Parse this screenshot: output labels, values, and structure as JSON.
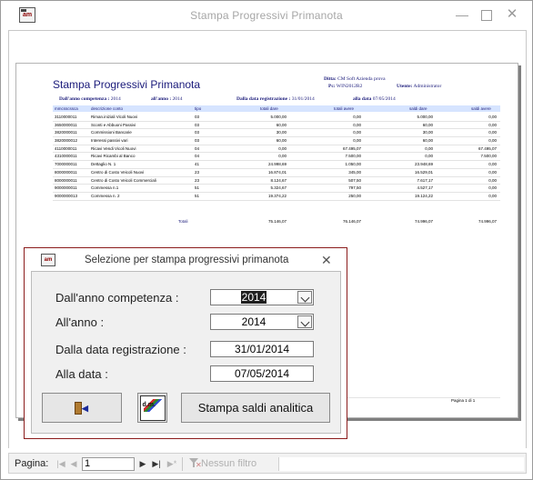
{
  "window": {
    "title": "Stampa Progressivi Primanota",
    "app_icon": "access-app-icon",
    "app_icon_text": "am",
    "controls": {
      "minimize": "—",
      "maximize": "",
      "close": "✕"
    }
  },
  "report": {
    "title": "Stampa Progressivi Primanota",
    "meta": {
      "ditta_label": "Ditta:",
      "ditta_value": "CM Soft Azienda prova",
      "pc_label": "Pc:",
      "pc_value": "WIN2012R2",
      "utente_label": "Utente:",
      "utente_value": "Administrator"
    },
    "params": {
      "anno_comp_label": "Dall'anno competenza :",
      "anno_comp_value": "2014",
      "anno_label": "all'anno :",
      "anno_value": "2014",
      "data_reg_label": "Dalla data registrazione :",
      "data_reg_value": "31/01/2014",
      "alla_data_label": "alla data",
      "alla_data_value": "07/05/2014"
    },
    "columns": [
      "mmcsscssca",
      "descrizione conto",
      "tipo",
      "totali dare",
      "totali avere",
      "saldi dare",
      "saldi avere"
    ],
    "rows": [
      [
        "3110000011",
        "Riman.iniziali Vicoli Nuovi",
        "03",
        "5.000,00",
        "0,00",
        "5.000,00",
        "0,00"
      ],
      [
        "3650000011",
        "Sconti e Abbuoni Passivi",
        "03",
        "60,00",
        "0,00",
        "60,00",
        "0,00"
      ],
      [
        "3820000011",
        "Commissioni Bancarie",
        "03",
        "30,00",
        "0,00",
        "30,00",
        "0,00"
      ],
      [
        "3820000012",
        "Interessi passivi vari",
        "03",
        "60,00",
        "0,00",
        "60,00",
        "0,00"
      ],
      [
        "4110000011",
        "Ricavi Vendi Vicoli Nuovi",
        "04",
        "0,00",
        "67.495,07",
        "0,00",
        "67.495,07"
      ],
      [
        "4310000011",
        "Ricavi Ricambi al Banco",
        "04",
        "0,00",
        "7.500,00",
        "0,00",
        "7.500,00"
      ],
      [
        "7000000011",
        "Dettaglio N. 1",
        "41",
        "24.998,69",
        "1.050,00",
        "23.948,69",
        "0,00"
      ],
      [
        "8000000011",
        "Centro di Costo Veicoli Nuovi",
        "23",
        "16.874,01",
        "345,00",
        "16.529,01",
        "0,00"
      ],
      [
        "8000000011",
        "Centro di Costo Veicoli Commerciali",
        "23",
        "8.124,67",
        "507,50",
        "7.617,17",
        "0,00"
      ],
      [
        "9000000011",
        "Commessa n.1",
        "51",
        "5.324,67",
        "797,50",
        "4.527,17",
        "0,00"
      ],
      [
        "9000000013",
        "Commessa n. 2",
        "51",
        "19.374,22",
        "250,00",
        "19.124,22",
        "0,00"
      ]
    ],
    "totals": {
      "label": "Totali",
      "dare": "75.146,07",
      "avere": "76.146,07",
      "saldi_dare": "74.996,07",
      "saldi_avere": "74.996,07"
    },
    "page_label": "Pagina 1 di 1"
  },
  "dialog": {
    "title": "Selezione per stampa progressivi primanota",
    "close": "✕",
    "fields": {
      "anno_competenza_label": "Dall'anno competenza :",
      "anno_competenza_value": "2014",
      "all_anno_label": "All'anno :",
      "all_anno_value": "2014",
      "data_registrazione_label": "Dalla data registrazione :",
      "data_registrazione_value": "31/01/2014",
      "alla_data_label": "Alla data :",
      "alla_data_value": "07/05/2014"
    },
    "buttons": {
      "exit_icon": "exit-door-icon",
      "print_icon": "print-preview-icon",
      "print_icon_text": "d.m.",
      "stampa_label": "Stampa saldi analitica"
    }
  },
  "navbar": {
    "label": "Pagina:",
    "record_value": "1",
    "filter_label": "Nessun filtro",
    "first": "|◀",
    "prev": "◀",
    "next": "▶",
    "last": "▶|",
    "new": "▶*"
  }
}
